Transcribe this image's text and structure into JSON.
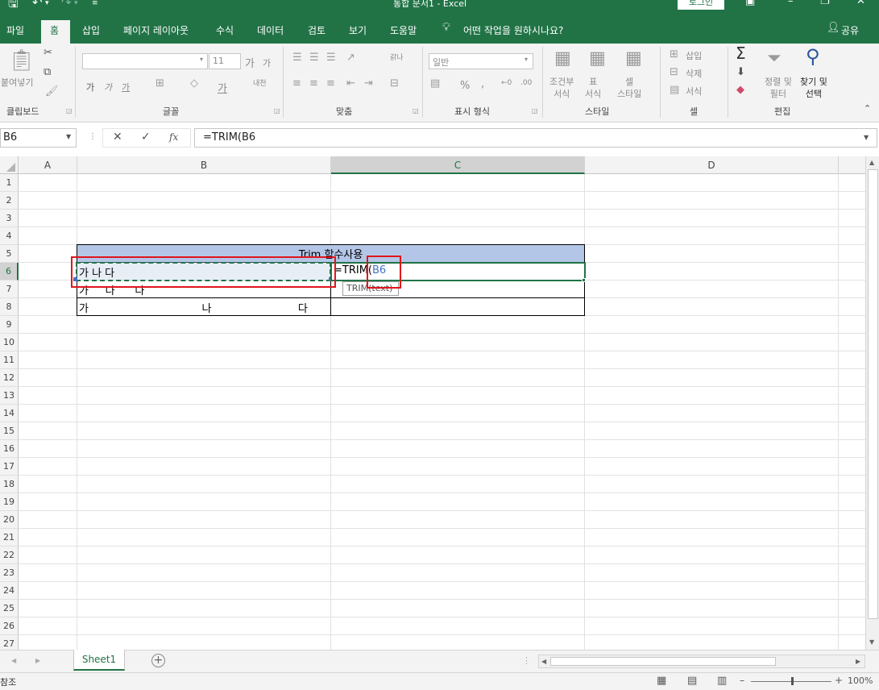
{
  "title_bar": {
    "doc_title": "통합 문서1  -  Excel",
    "login_label": "로그인"
  },
  "tabs": [
    {
      "label": "파일"
    },
    {
      "label": "홈"
    },
    {
      "label": "삽입"
    },
    {
      "label": "페이지 레이아웃"
    },
    {
      "label": "수식"
    },
    {
      "label": "데이터"
    },
    {
      "label": "검토"
    },
    {
      "label": "보기"
    },
    {
      "label": "도움말"
    }
  ],
  "tell_me": "어떤 작업을 원하시나요?",
  "share_label": "공유",
  "ribbon": {
    "clipboard": {
      "label": "클립보드",
      "paste_label": "붙여넣기"
    },
    "font": {
      "label": "글꼴",
      "font_size": "11",
      "bold": "가",
      "italic": "가",
      "underline": "가",
      "grow": "가",
      "shrink": "가",
      "color": "가",
      "phonetic": "내천"
    },
    "alignment": {
      "label": "맞춤",
      "wrap": "갉나"
    },
    "number": {
      "label": "표시 형식",
      "format_value": "일반",
      "percent": "%",
      "comma": ","
    },
    "styles": {
      "label": "스타일",
      "conditional": "조건부\n서식",
      "table": "표\n서식",
      "cell_style": "셀\n스타일"
    },
    "cells": {
      "label": "셀",
      "insert": "삽입",
      "delete": "삭제",
      "format": "서식"
    },
    "editing": {
      "label": "편집",
      "sort_filter": "정렬 및\n필터",
      "find_select": "찾기 및\n선택"
    }
  },
  "formula_bar": {
    "name_box": "B6",
    "formula": "=TRIM(B6"
  },
  "columns": [
    {
      "label": "A",
      "selected": false
    },
    {
      "label": "B",
      "selected": false
    },
    {
      "label": "C",
      "selected": true
    },
    {
      "label": "D",
      "selected": false
    }
  ],
  "rows": [
    "1",
    "2",
    "3",
    "4",
    "5",
    "6",
    "7",
    "8",
    "9",
    "10",
    "11",
    "12",
    "13",
    "14",
    "15",
    "16",
    "17",
    "18",
    "19",
    "20",
    "21",
    "22",
    "23",
    "24",
    "25",
    "26",
    "27"
  ],
  "selected_row": "6",
  "cells": {
    "header": "Trim 함수사용",
    "b6": "가 나 다",
    "b7": "가     나      다",
    "b8": "가                                  나                          다",
    "c6_prefix": "=TRIM(",
    "c6_ref": "B6",
    "tooltip": "TRIM(text)"
  },
  "colors": {
    "brand": "#217346",
    "header_fill": "#b4c6e7",
    "highlight_red": "#e0161c",
    "ref_blue": "#4472c4"
  },
  "sheet_tabs": [
    {
      "label": "Sheet1",
      "active": true
    }
  ],
  "status": {
    "mode": "참조",
    "zoom": "100%"
  }
}
